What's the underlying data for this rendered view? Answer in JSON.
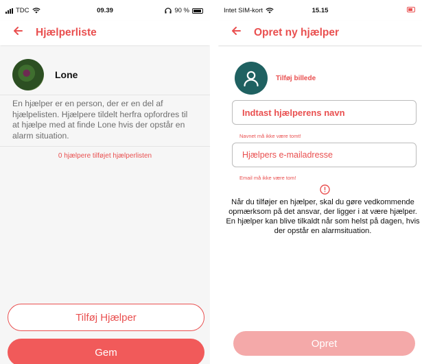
{
  "colors": {
    "accent": "#e94f4f",
    "avatar_bg": "#1f6161",
    "disabled_button": "#f4a9a9",
    "list_bg": "#f6f6f6"
  },
  "left_screen": {
    "status_bar": {
      "carrier": "TDC",
      "time": "09.39",
      "battery": "90 %",
      "icons": [
        "signal-icon",
        "wifi-icon",
        "headphones-icon",
        "battery-icon"
      ]
    },
    "header": {
      "title": "Hjælperliste",
      "back_icon": "arrow-left-icon"
    },
    "profile": {
      "name": "Lone"
    },
    "info_text": "En hjælper er en person, der er en del af hjælpelisten. Hjælpere tildelt herfra opfordres til at hjælpe med at finde Lone hvis der opstår en alarm situation.",
    "count_text": "0 hjælpere tilføjet hjælperlisten",
    "add_helper_button": "Tilføj Hjælper",
    "save_button": "Gem"
  },
  "right_screen": {
    "status_bar": {
      "carrier": "Intet SIM-kort",
      "time": "15.15",
      "icons": [
        "wifi-icon",
        "battery-charging-icon"
      ]
    },
    "header": {
      "title": "Opret ny hjælper",
      "back_icon": "arrow-left-icon"
    },
    "add_photo_label": "Tilføj billede",
    "name_field": {
      "placeholder": "Indtast hjælperens navn",
      "error": "Navnet må ikke være tomt!"
    },
    "email_field": {
      "placeholder": "Hjælpers e-mailadresse",
      "error": "Email må ikke være tom!"
    },
    "notice_paragraph_1": "Når du tilføjer en hjælper, skal du gøre vedkommende opmærksom på det ansvar, der ligger i at være hjælper.",
    "notice_paragraph_2": "En hjælper kan blive tilkaldt når som helst på dagen, hvis der opstår en alarmsituation.",
    "create_button": "Opret"
  }
}
